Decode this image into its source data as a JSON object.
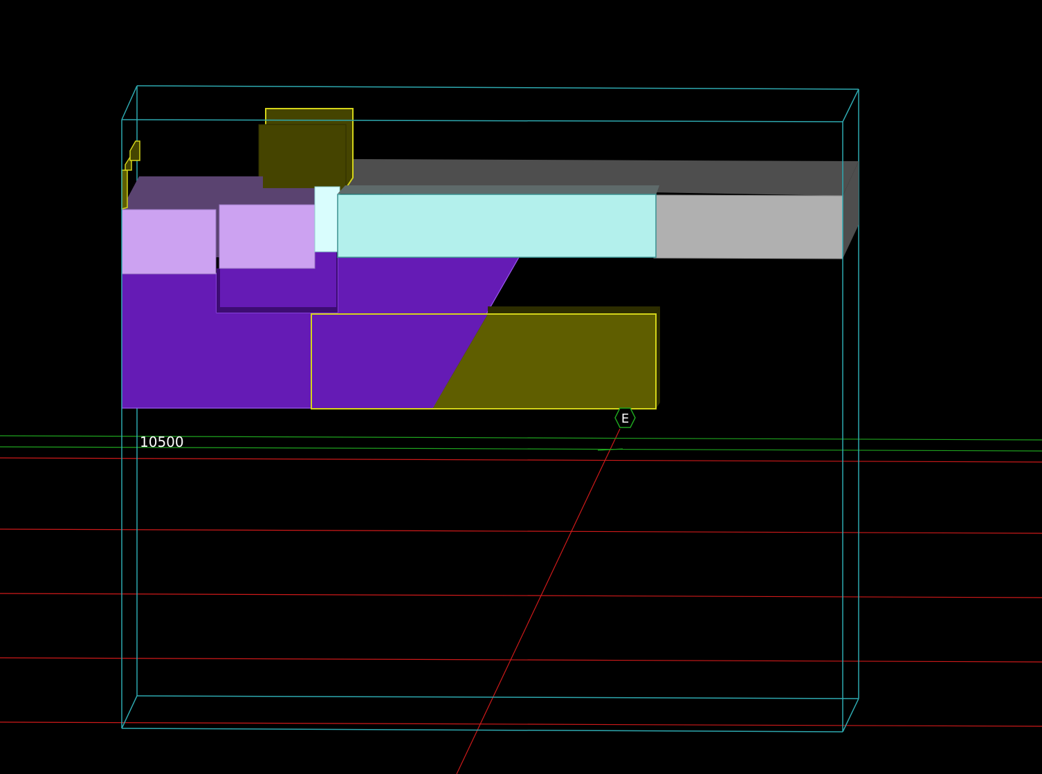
{
  "viewport": {
    "background": "#000000",
    "level_label": "10500",
    "grid_bubble_label": "E"
  },
  "colors": {
    "section_box": "#2ea9b0",
    "level_line": "#1fa51f",
    "grid_line": "#d01a1a",
    "purple_solid": "#651bb5",
    "purple_dark": "#3d0c73",
    "purple_top": "#5a4370",
    "lilac": "#cca2f1",
    "olive": "#5f5e00",
    "olive_dark": "#454400",
    "olive_edge": "#d5d51a",
    "cyan_light": "#b3f0ec",
    "cyan_pale": "#d9fdfd",
    "gray_light": "#b0b0b0",
    "gray_dark": "#4e4e4e"
  },
  "icons": {
    "grid_bubble": "hexagon-grid-head-icon"
  }
}
